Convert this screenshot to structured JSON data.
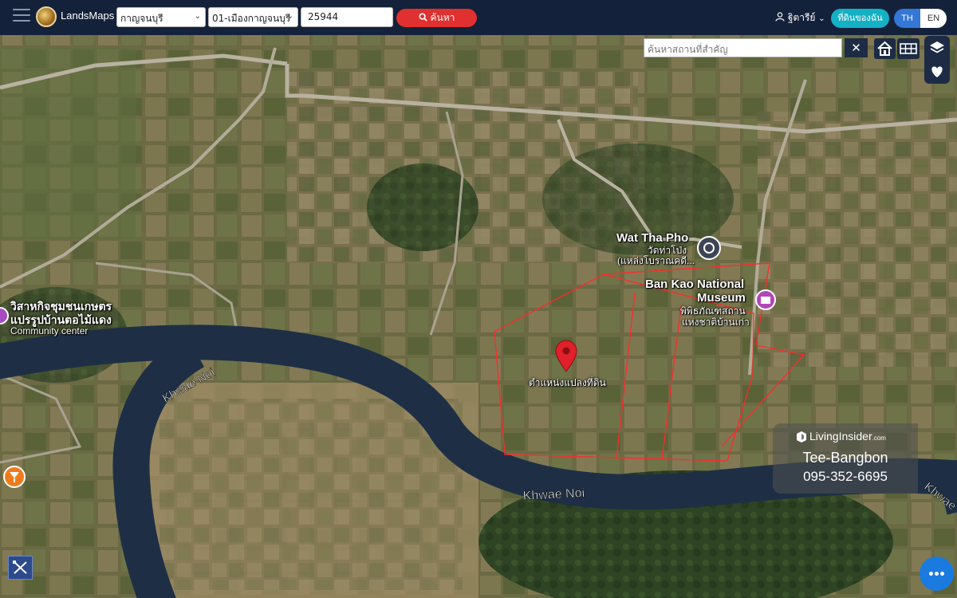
{
  "header": {
    "brand": "LandsMaps",
    "province": "กาญจนบุรี",
    "district": "01-เมืองกาญจนบุรี",
    "parcel_number": "25944",
    "search_label": "ค้นหา",
    "user_name": "ฐิตารีย์",
    "my_location_label": "ที่ดินของฉัน",
    "lang_th": "TH",
    "lang_en": "EN"
  },
  "map_controls": {
    "place_search_placeholder": "ค้นหาสถานที่สำคัญ",
    "clear_symbol": "✕"
  },
  "map": {
    "pin_label": "ตำแหน่งแปลงที่ดิน",
    "river_labels": [
      "Khwae Noi",
      "Khwae Noi",
      "Khwae"
    ],
    "places": {
      "wat_tha_pho_en": "Wat Tha Pho",
      "wat_tha_pho_th": "วัดท่าโป่ง",
      "wat_tha_pho_sub": "(แหล่งโบราณคดี...",
      "museum_en_1": "Ban Kao National",
      "museum_en_2": "Museum",
      "museum_th_1": "พิพิธภัณฑสถาน",
      "museum_th_2": "แห่งชาติบ้านเก่า",
      "community_th_1": "วิสาหกิจชุมชนเกษตร",
      "community_th_2": "แปรรูปบ้านตอไม้แดง",
      "community_en": "Community center"
    },
    "colors": {
      "parcel_outline": "#ff2a2a",
      "pin": "#e0202a",
      "river": "#1e2f45"
    }
  },
  "watermark": {
    "brand": "LivingInsider",
    "brand_suffix": ".com",
    "name": "Tee-Bangbon",
    "phone": "095-352-6695"
  }
}
